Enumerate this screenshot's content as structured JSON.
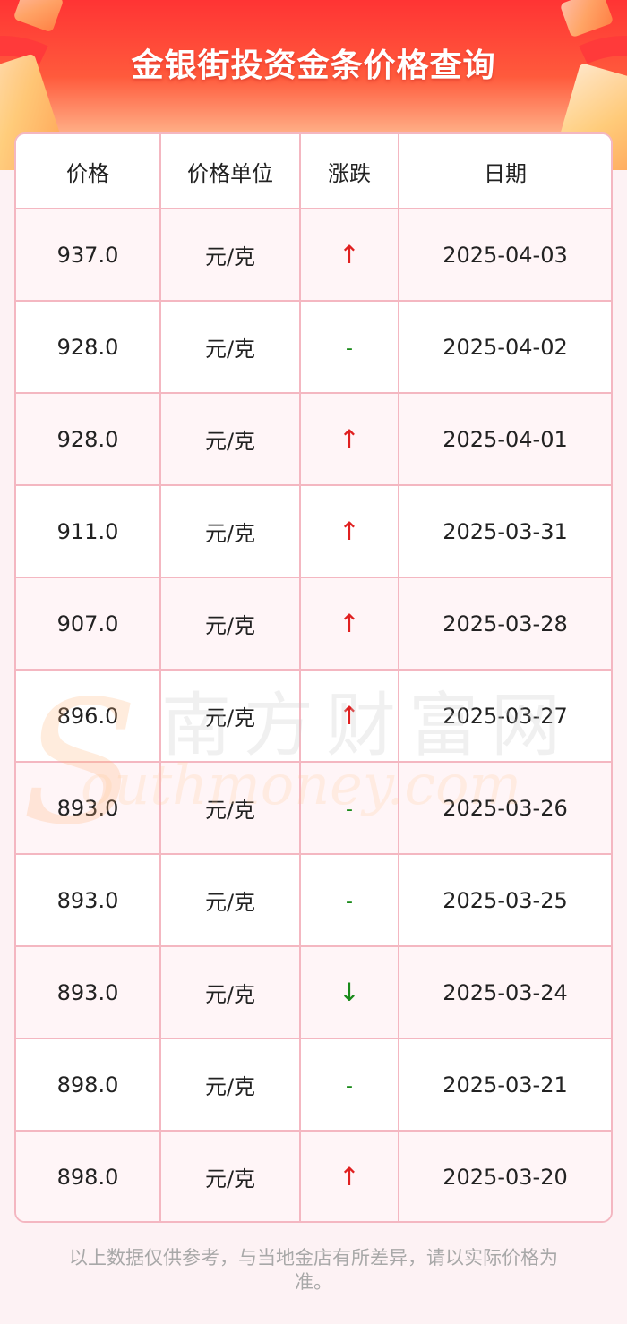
{
  "header": {
    "title": "金银街投资金条价格查询"
  },
  "table": {
    "columns": [
      "价格",
      "价格单位",
      "涨跌",
      "日期"
    ],
    "rows": [
      {
        "price": "937.0",
        "unit": "元/克",
        "change": "↑",
        "change_type": "up",
        "date": "2025-04-03"
      },
      {
        "price": "928.0",
        "unit": "元/克",
        "change": "-",
        "change_type": "flat",
        "date": "2025-04-02"
      },
      {
        "price": "928.0",
        "unit": "元/克",
        "change": "↑",
        "change_type": "up",
        "date": "2025-04-01"
      },
      {
        "price": "911.0",
        "unit": "元/克",
        "change": "↑",
        "change_type": "up",
        "date": "2025-03-31"
      },
      {
        "price": "907.0",
        "unit": "元/克",
        "change": "↑",
        "change_type": "up",
        "date": "2025-03-28"
      },
      {
        "price": "896.0",
        "unit": "元/克",
        "change": "↑",
        "change_type": "up",
        "date": "2025-03-27"
      },
      {
        "price": "893.0",
        "unit": "元/克",
        "change": "-",
        "change_type": "flat",
        "date": "2025-03-26"
      },
      {
        "price": "893.0",
        "unit": "元/克",
        "change": "-",
        "change_type": "flat",
        "date": "2025-03-25"
      },
      {
        "price": "893.0",
        "unit": "元/克",
        "change": "↓",
        "change_type": "down",
        "date": "2025-03-24"
      },
      {
        "price": "898.0",
        "unit": "元/克",
        "change": "-",
        "change_type": "flat",
        "date": "2025-03-21"
      },
      {
        "price": "898.0",
        "unit": "元/克",
        "change": "↑",
        "change_type": "up",
        "date": "2025-03-20"
      }
    ]
  },
  "watermark": {
    "cn": "南方财富网",
    "en_initial": "S",
    "en": "outhmoney.com"
  },
  "footnote": "以上数据仅供参考，与当地金店有所差异，请以实际价格为准。",
  "colors": {
    "up": "#e02020",
    "down": "#1a8a1a",
    "flat": "#1a8a1a",
    "border": "#f4b7c1",
    "banner": "#ff3434"
  }
}
